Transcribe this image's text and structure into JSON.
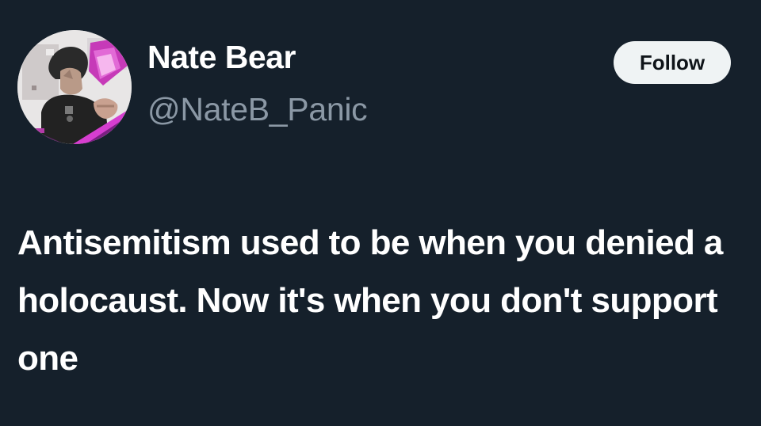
{
  "user": {
    "display_name": "Nate Bear",
    "handle": "@NateB_Panic",
    "avatar_icon": "user-avatar-photo"
  },
  "actions": {
    "follow_label": "Follow"
  },
  "tweet": {
    "text": "Antisemitism used to be when you denied a holocaust. Now it's when you don't support one"
  },
  "colors": {
    "background": "#15202b",
    "name": "#ffffff",
    "handle": "#8b98a5",
    "follow_bg": "#eff3f4",
    "follow_text": "#0f1419"
  }
}
